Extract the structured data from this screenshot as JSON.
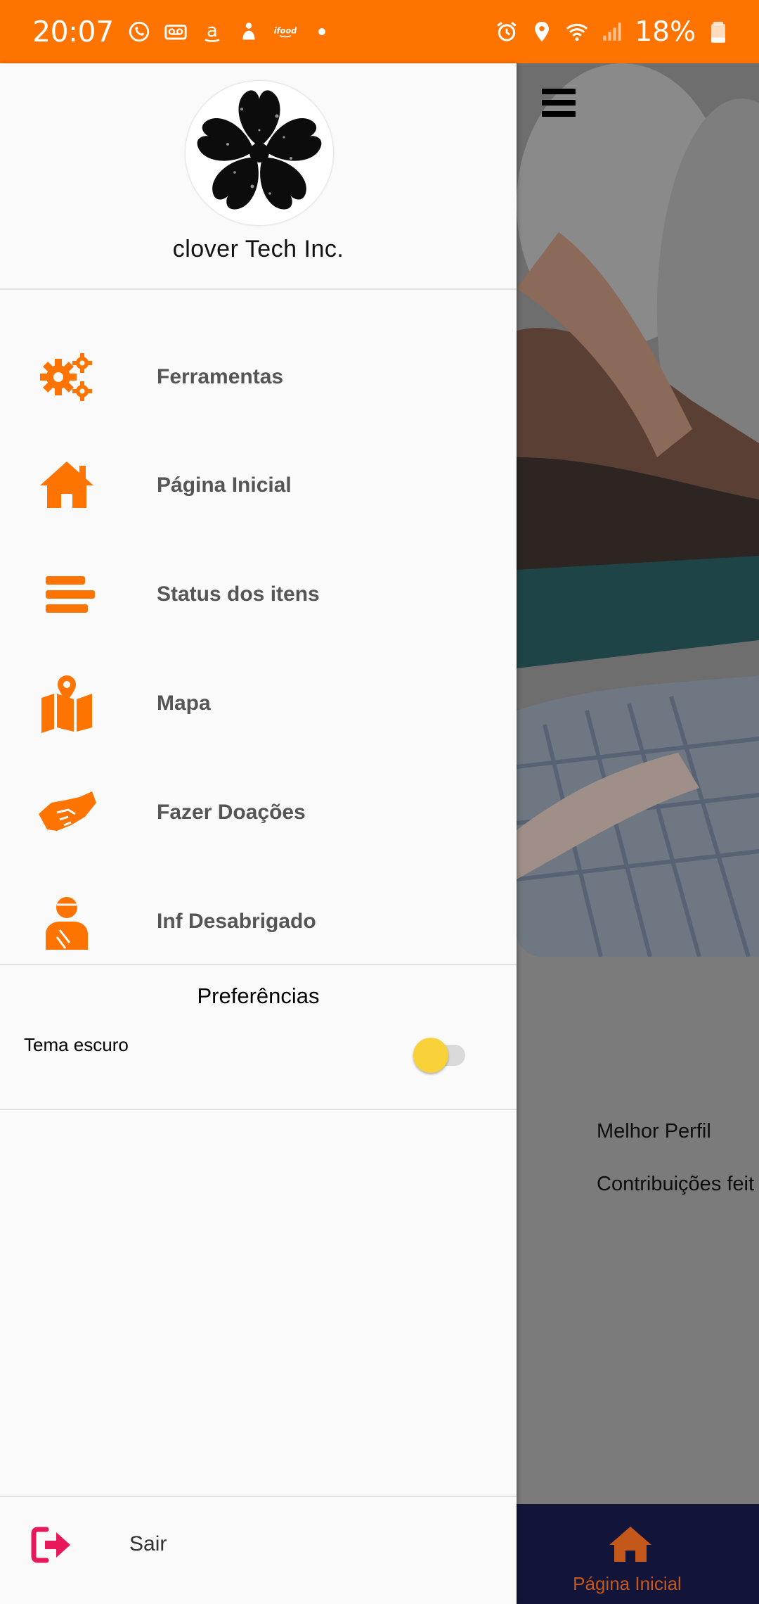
{
  "status_bar": {
    "time": "20:07",
    "battery": "18%",
    "left_icons": [
      "whatsapp-icon",
      "voicemail-icon",
      "amazon-icon",
      "app-icon",
      "ifood-icon",
      "dot-icon"
    ],
    "right_icons": [
      "alarm-icon",
      "location-icon",
      "wifi-icon",
      "signal-icon",
      "battery-icon"
    ],
    "background_color": "#ff7300"
  },
  "drawer": {
    "company_name": "clover Tech Inc.",
    "menu": [
      {
        "label": "Ferramentas",
        "icon": "gears-icon"
      },
      {
        "label": "Página Inicial",
        "icon": "home-icon"
      },
      {
        "label": "Status dos itens",
        "icon": "bars-icon"
      },
      {
        "label": "Mapa",
        "icon": "map-icon"
      },
      {
        "label": "Fazer Doações",
        "icon": "handshake-icon"
      },
      {
        "label": "Inf Desabrigado",
        "icon": "person-icon"
      }
    ],
    "preferences_title": "Preferências",
    "dark_theme_label": "Tema escuro",
    "dark_theme_enabled": false,
    "logout_label": "Sair",
    "accent_color": "#ff7300",
    "logout_color": "#e8185a"
  },
  "background_page": {
    "best_profile_label": "Melhor Perfil",
    "contributions_label": "Contribuições feit",
    "bottom_nav": {
      "label": "Página Inicial",
      "icon": "home-icon"
    }
  }
}
